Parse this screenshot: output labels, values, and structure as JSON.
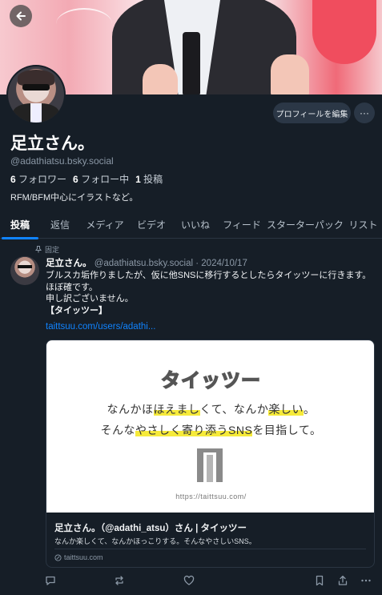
{
  "profile": {
    "display_name": "足立さん。",
    "handle": "@adathiatsu.bsky.social",
    "followers_count": "6",
    "followers_label": "フォロワー",
    "following_count": "6",
    "following_label": "フォロー中",
    "posts_count": "1",
    "posts_label": "投稿",
    "bio": "RFM/BFM中心にイラストなど。",
    "edit_button_label": "プロフィールを編集",
    "more_button_label": "···"
  },
  "tabs": [
    {
      "label": "投稿",
      "active": true
    },
    {
      "label": "返信",
      "active": false
    },
    {
      "label": "メディア",
      "active": false
    },
    {
      "label": "ビデオ",
      "active": false
    },
    {
      "label": "いいね",
      "active": false
    },
    {
      "label": "フィード",
      "active": false
    },
    {
      "label": "スターターパック",
      "active": false
    },
    {
      "label": "リスト",
      "active": false
    }
  ],
  "post": {
    "pinned_label": "固定",
    "author_name": "足立さん。",
    "author_handle": "@adathiatsu.bsky.social",
    "separator": "·",
    "date": "2024/10/17",
    "text_lines": [
      "ブルスカ垢作りましたが、仮に他SNSに移行するとしたらタイッツーに行きます。",
      "ほぼ確です。",
      "申し訳ございません。",
      "【タイッツー】"
    ],
    "link_text": "taittsuu.com/users/adathi...",
    "embed": {
      "image_logo": "タイッツー",
      "image_line1_pre": "なんかほ",
      "image_line1_hl1": "ほえまし",
      "image_line1_mid": "くて、なんか",
      "image_line1_hl2": "楽しい",
      "image_line1_post": "。",
      "image_line2_pre": "そんな",
      "image_line2_hl": "やさしく寄り添うSNS",
      "image_line2_post": "を目指して。",
      "image_url": "https://taittsuu.com/",
      "title": "足立さん。（@adathi_atsu）さん | タイッツー",
      "description": "なんか楽しくて、なんかほっこりする。そんなやさしいSNS。",
      "domain": "taittsuu.com"
    }
  },
  "colors": {
    "background": "#161e27",
    "accent": "#1083fe",
    "muted_text": "#8b98a6",
    "highlight": "#f6ea3a"
  },
  "icons": [
    "back-arrow-icon",
    "pin-icon",
    "globe-icon",
    "reply-icon",
    "repost-icon",
    "like-icon",
    "bookmark-icon",
    "share-icon",
    "more-dots-icon"
  ]
}
